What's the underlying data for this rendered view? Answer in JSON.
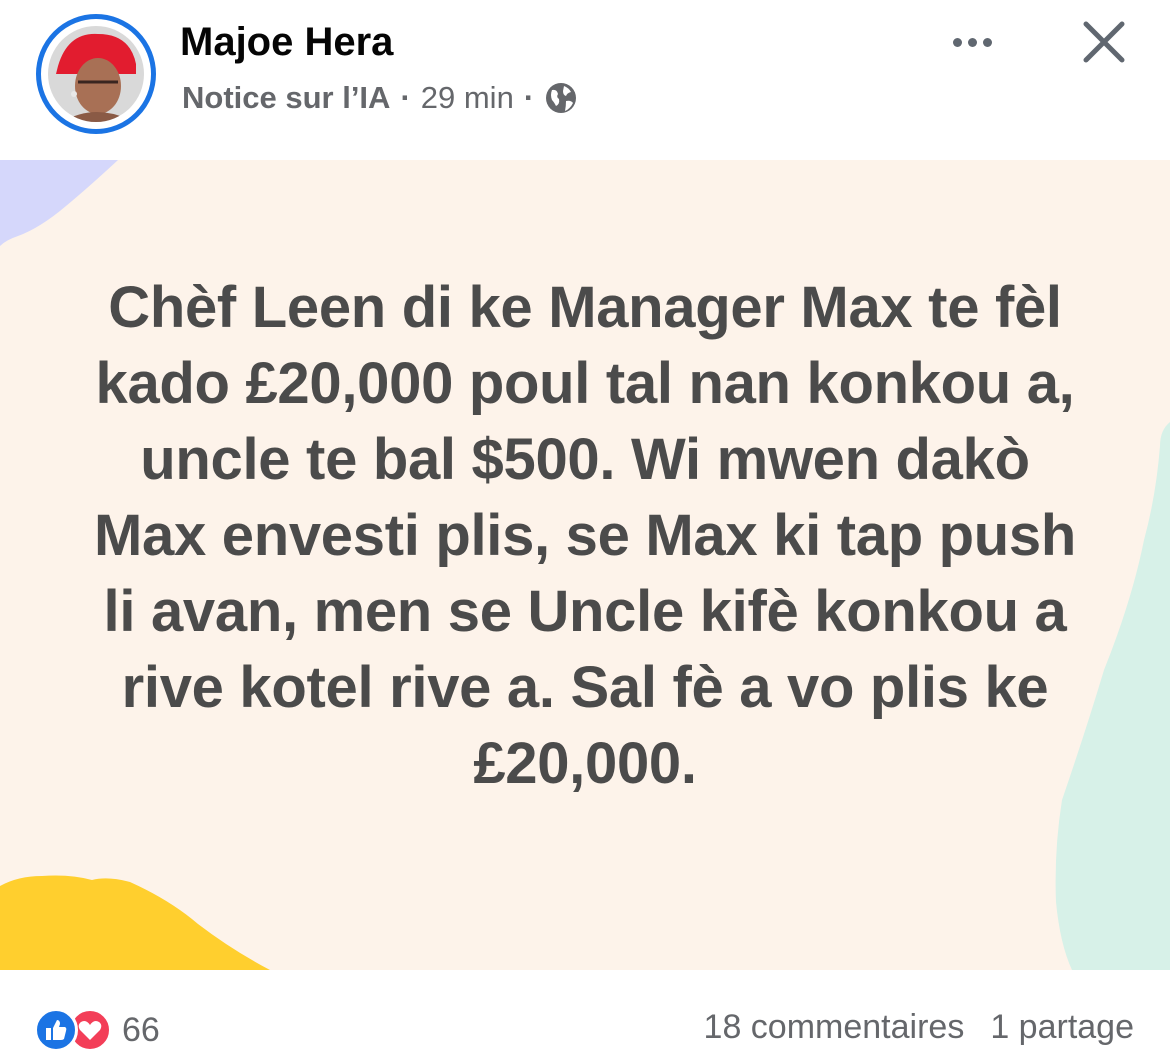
{
  "post": {
    "author_name": "Majoe Hera",
    "label": "Notice sur l’IA",
    "separator": "·",
    "time": "29 min",
    "audience_icon": "globe-icon",
    "text": "Chèf Leen di ke Manager Max te fèl kado £20,000 poul tal nan konkou a, uncle te bal $500. Wi mwen dakò Max envesti plis, se Max ki tap push li avan, men se Uncle kifè konkou a rive kotel rive a. Sal fè a vo plis ke £20,000."
  },
  "footer": {
    "reaction_count": "66",
    "comments": "18 commentaires",
    "shares": "1 partage"
  },
  "colors": {
    "accent": "#1b74e4",
    "love": "#f33e58",
    "post_background": "#fdf3ea",
    "yellow_shape": "#ffcf2e",
    "mint_shape": "#d7f1e8",
    "lavender_shape": "#d5d7fb"
  }
}
